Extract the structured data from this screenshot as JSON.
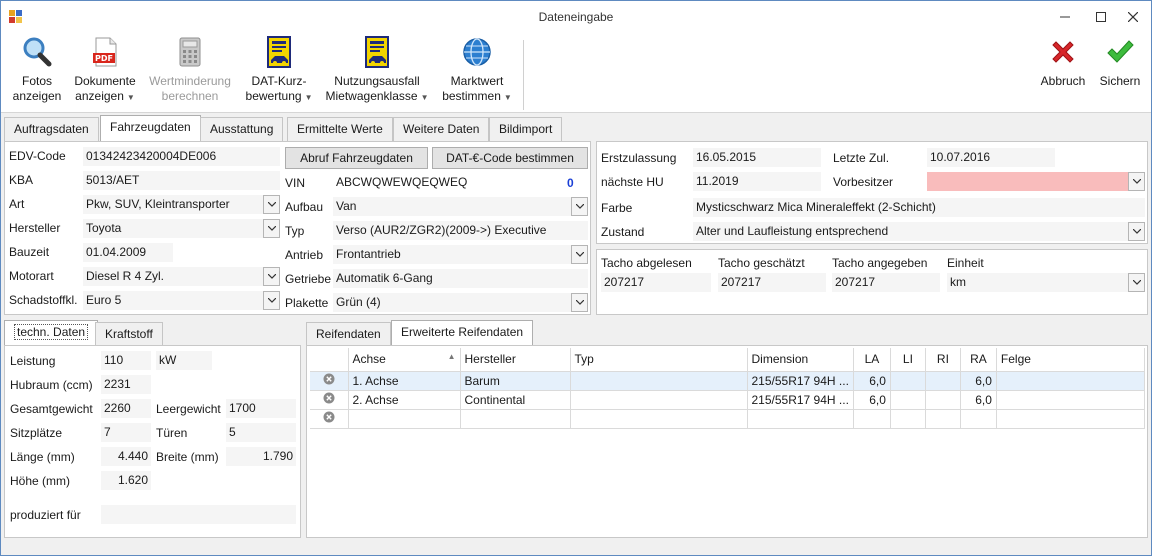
{
  "window": {
    "title": "Dateneingabe"
  },
  "toolbar": {
    "fotos": "Fotos\nanzeigen",
    "dokumente_l1": "Dokumente",
    "dokumente_l2": "anzeigen",
    "wertminderung_l1": "Wertminderung",
    "wertminderung_l2": "berechnen",
    "dat_kurz_l1": "DAT-Kurz-",
    "dat_kurz_l2": "bewertung",
    "nutzungsausfall_l1": "Nutzungsausfall",
    "nutzungsausfall_l2": "Mietwagenklasse",
    "marktwert_l1": "Marktwert",
    "marktwert_l2": "bestimmen",
    "abbruch": "Abbruch",
    "sichern": "Sichern",
    "fotos_l1": "Fotos",
    "fotos_l2": "anzeigen"
  },
  "tabs": [
    "Auftragsdaten",
    "Fahrzeugdaten",
    "Ausstattung",
    "Ermittelte Werte",
    "Weitere Daten",
    "Bildimport"
  ],
  "vehicle": {
    "edv_code_label": "EDV-Code",
    "edv_code": "01342423420004DE006",
    "kba_label": "KBA",
    "kba": "5013/AET",
    "art_label": "Art",
    "art": "Pkw, SUV, Kleintransporter",
    "hersteller_label": "Hersteller",
    "hersteller": "Toyota",
    "bauzeit_label": "Bauzeit",
    "bauzeit": "01.04.2009",
    "motorart_label": "Motorart",
    "motorart": "Diesel R 4 Zyl.",
    "schadstoff_label": "Schadstoffkl.",
    "schadstoff": "Euro 5",
    "abruf_button": "Abruf Fahrzeugdaten",
    "dat_code_button": "DAT-€-Code bestimmen",
    "vin_label": "VIN",
    "vin": "ABCWQWEWQEQWEQ",
    "vin_count": "0",
    "aufbau_label": "Aufbau",
    "aufbau": "Van",
    "typ_label": "Typ",
    "typ": "Verso (AUR2/ZGR2)(2009->) Executive",
    "antrieb_label": "Antrieb",
    "antrieb": "Frontantrieb",
    "getriebe_label": "Getriebe",
    "getriebe": "Automatik 6-Gang",
    "plakette_label": "Plakette",
    "plakette": "Grün (4)"
  },
  "registration": {
    "erstzulassung_label": "Erstzulassung",
    "erstzulassung": "16.05.2015",
    "letzte_zul_label": "Letzte Zul.",
    "letzte_zul": "10.07.2016",
    "naechste_hu_label": "nächste HU",
    "naechste_hu": "11.2019",
    "vorbesitzer_label": "Vorbesitzer",
    "vorbesitzer": "",
    "farbe_label": "Farbe",
    "farbe": "Mysticschwarz Mica Mineraleffekt (2-Schicht)",
    "zustand_label": "Zustand",
    "zustand": "Alter und Laufleistung entsprechend",
    "vorbesitzer_color": "#f9bcbc"
  },
  "tacho": {
    "abgelesen_label": "Tacho abgelesen",
    "abgelesen": "207217",
    "geschaetzt_label": "Tacho geschätzt",
    "geschaetzt": "207217",
    "angegeben_label": "Tacho angegeben",
    "angegeben": "207217",
    "einheit_label": "Einheit",
    "einheit": "km"
  },
  "tech_tabs": [
    "techn. Daten",
    "Kraftstoff"
  ],
  "tech": {
    "leistung_label": "Leistung",
    "leistung": "110",
    "leistung_unit": "kW",
    "hubraum_label": "Hubraum (ccm)",
    "hubraum": "2231",
    "gesamtgewicht_label": "Gesamtgewicht",
    "gesamtgewicht": "2260",
    "leergewicht_label": "Leergewicht",
    "leergewicht": "1700",
    "sitzplaetze_label": "Sitzplätze",
    "sitzplaetze": "7",
    "tueren_label": "Türen",
    "tueren": "5",
    "laenge_label": "Länge (mm)",
    "laenge": "4.440",
    "breite_label": "Breite (mm)",
    "breite": "1.790",
    "hoehe_label": "Höhe (mm)",
    "hoehe": "1.620",
    "produziert_label": "produziert für",
    "produziert": ""
  },
  "tire_tabs": [
    "Reifendaten",
    "Erweiterte Reifendaten"
  ],
  "tires": {
    "headers": [
      "Achse",
      "Hersteller",
      "Typ",
      "Dimension",
      "LA",
      "LI",
      "RI",
      "RA",
      "Felge"
    ],
    "rows": [
      [
        "1. Achse",
        "Barum",
        "",
        "215/55R17 94H ...",
        "6,0",
        "",
        "",
        "6,0",
        ""
      ],
      [
        "2. Achse",
        "Continental",
        "",
        "215/55R17 94H ...",
        "6,0",
        "",
        "",
        "6,0",
        ""
      ],
      [
        "",
        "",
        "",
        "",
        "",
        "",
        "",
        "",
        ""
      ]
    ],
    "selected_row_color": "#e5f0fb"
  }
}
